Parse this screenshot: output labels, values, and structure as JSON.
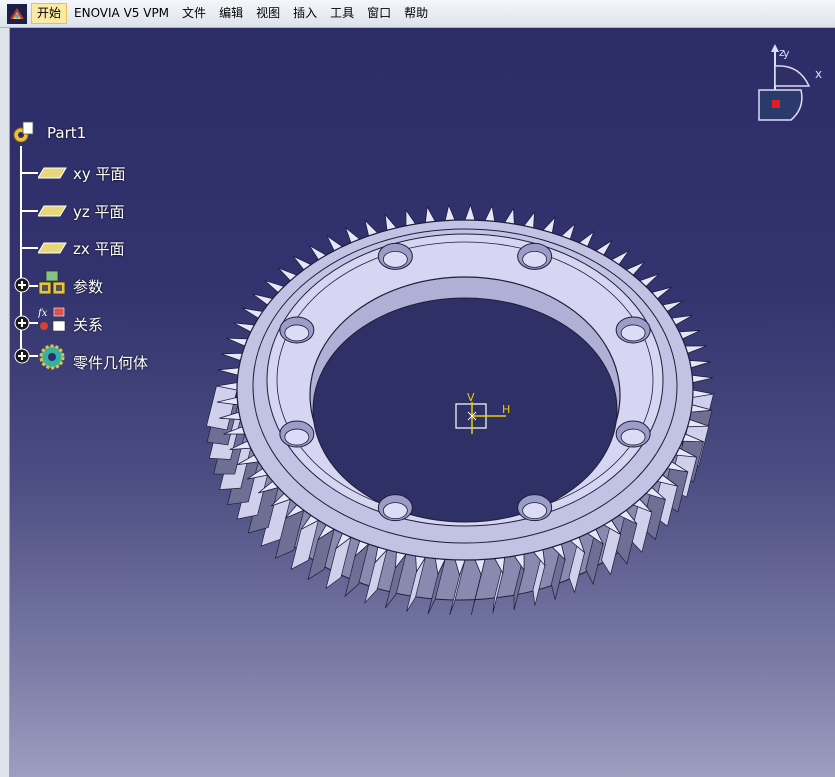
{
  "menubar": {
    "items": [
      {
        "label": "开始",
        "active": true
      },
      {
        "label": "ENOVIA V5 VPM"
      },
      {
        "label": "文件"
      },
      {
        "label": "编辑"
      },
      {
        "label": "视图"
      },
      {
        "label": "插入"
      },
      {
        "label": "工具"
      },
      {
        "label": "窗口"
      },
      {
        "label": "帮助"
      }
    ]
  },
  "tree": {
    "root": {
      "label": "Part1",
      "icon": "part-icon"
    },
    "children": [
      {
        "label": "xy 平面",
        "icon": "plane-icon"
      },
      {
        "label": "yz 平面",
        "icon": "plane-icon"
      },
      {
        "label": "zx 平面",
        "icon": "plane-icon"
      },
      {
        "label": "参数",
        "icon": "parameters-icon",
        "expandable": true
      },
      {
        "label": "关系",
        "icon": "relations-icon",
        "expandable": true
      },
      {
        "label": "零件几何体",
        "icon": "part-body-icon",
        "expandable": true
      }
    ]
  },
  "compass": {
    "axis_z": "z",
    "axis_y": "y",
    "axis_x": "x"
  },
  "triad": {
    "v_label": "V",
    "h_label": "H"
  },
  "colors": {
    "viewport_top": "#2c2c68",
    "viewport_bottom": "#9d9ec0",
    "gear_face": "#d2d2f0",
    "gear_shadow": "#6a6a8e",
    "tree_line": "#ffffff",
    "plane_fill": "#e8d77a",
    "triad_yellow": "#e8d000"
  }
}
